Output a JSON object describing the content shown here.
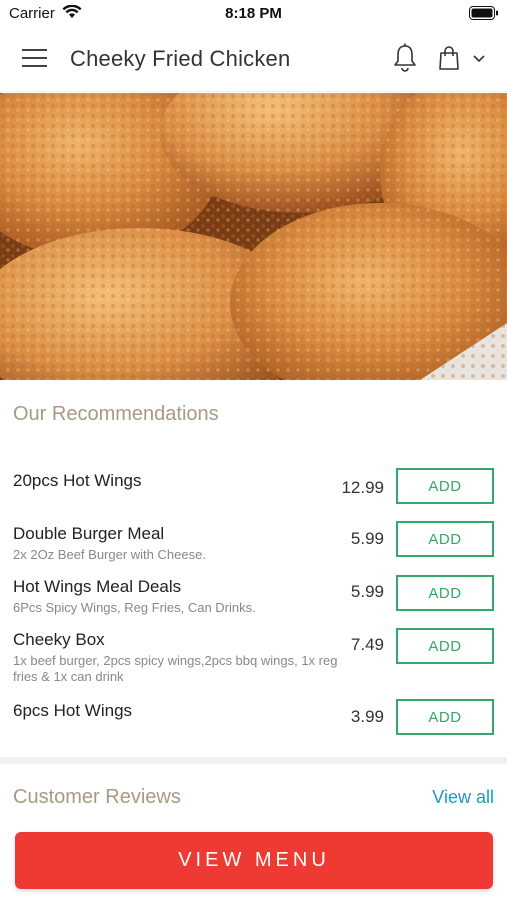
{
  "status_bar": {
    "carrier": "Carrier",
    "time": "8:18 PM"
  },
  "header": {
    "title": "Cheeky Fried Chicken",
    "icons": [
      "menu-icon",
      "bell-icon",
      "shopping-bag-icon",
      "chevron-down-icon"
    ]
  },
  "recommendations": {
    "title": "Our Recommendations",
    "items": [
      {
        "name": "20pcs Hot Wings",
        "description": "",
        "price": "12.99",
        "button": "ADD"
      },
      {
        "name": "Double Burger Meal",
        "description": "2x 2Oz Beef Burger with Cheese.",
        "price": "5.99",
        "button": "ADD"
      },
      {
        "name": "Hot Wings Meal Deals",
        "description": "6Pcs Spicy Wings, Reg Fries, Can Drinks.",
        "price": "5.99",
        "button": "ADD"
      },
      {
        "name": "Cheeky Box",
        "description": "1x beef burger, 2pcs spicy wings,2pcs bbq wings, 1x reg fries & 1x can drink",
        "price": "7.49",
        "button": "ADD"
      },
      {
        "name": "6pcs Hot Wings",
        "description": "",
        "price": "3.99",
        "button": "ADD"
      }
    ]
  },
  "reviews": {
    "title": "Customer Reviews",
    "link": "View all"
  },
  "footer": {
    "button": "VIEW MENU"
  },
  "colors": {
    "accent_red": "#ee3a33",
    "add_green": "#34a86a",
    "link_blue": "#1a9cc0",
    "section_title": "#a89a80"
  }
}
